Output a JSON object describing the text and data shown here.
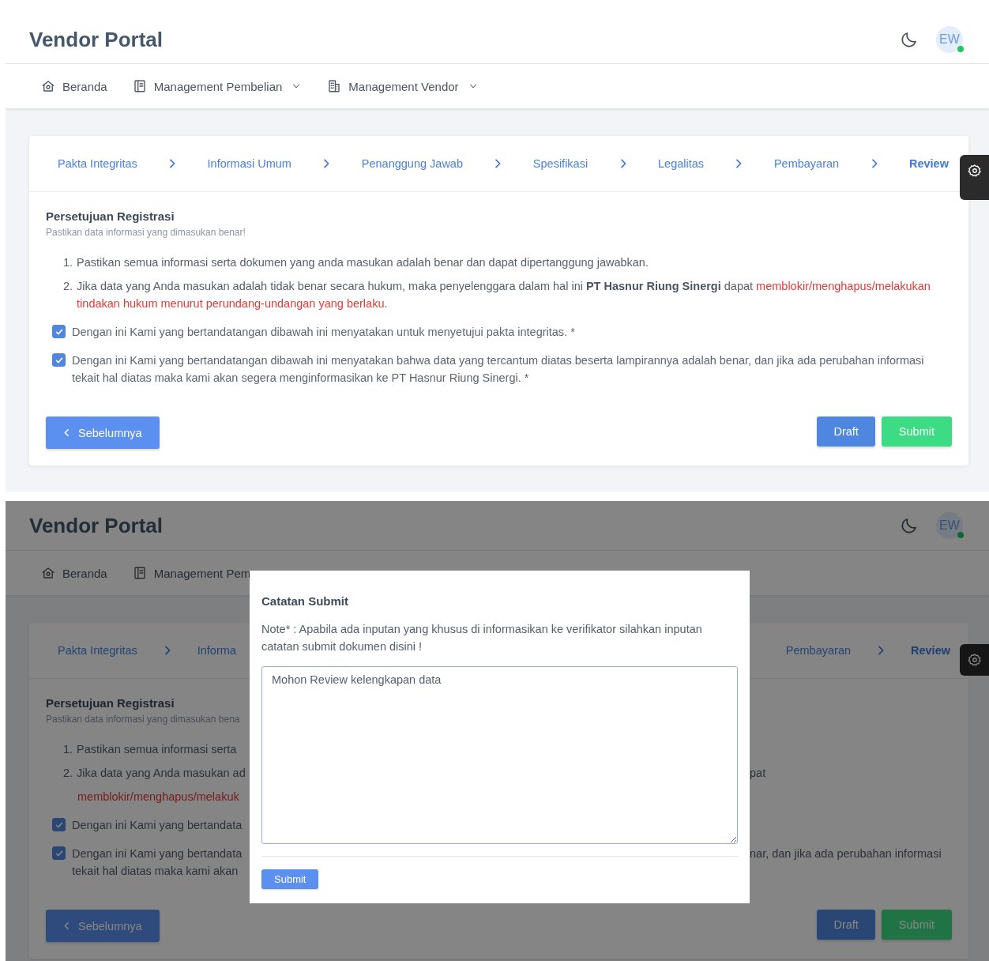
{
  "review_page": {
    "header": {
      "title": "Vendor Portal",
      "avatar": "EW",
      "online": true
    },
    "nav": [
      {
        "label": "Beranda",
        "dropdown": false
      },
      {
        "label": "Management Pembelian",
        "dropdown": true
      },
      {
        "label": "Management Vendor",
        "dropdown": true
      }
    ],
    "steps": [
      {
        "label": "Pakta Integritas",
        "selected": false
      },
      {
        "label": "Informasi Umum",
        "selected": false
      },
      {
        "label": "Penanggung Jawab",
        "selected": false
      },
      {
        "label": "Spesifikasi",
        "selected": false
      },
      {
        "label": "Legalitas",
        "selected": false
      },
      {
        "label": "Pembayaran",
        "selected": false
      },
      {
        "label": "Review",
        "selected": true
      }
    ],
    "section": {
      "title": "Persetujuan Registrasi",
      "subtitle": "Pastikan data informasi yang dimasukan benar!"
    },
    "terms": [
      {
        "number": "1.",
        "parts": [
          {
            "kind": "text",
            "text": "Pastikan semua informasi serta dokumen yang anda masukan adalah benar dan dapat dipertanggung jawabkan."
          }
        ]
      },
      {
        "number": "2.",
        "parts": [
          {
            "kind": "text",
            "text": "Jika data yang Anda masukan adalah tidak benar secara hukum, maka penyelenggara dalam hal ini **PT Hasnur Riung Sinergi** dapat "
          },
          {
            "kind": "warning",
            "text": "memblokir/menghapus/melakukan tindakan hukum menurut perundang-undangan yang berlaku"
          },
          {
            "kind": "text",
            "text": "."
          }
        ]
      }
    ],
    "agreements": [
      {
        "label": "Dengan ini Kami yang bertandatangan dibawah ini menyatakan untuk menyetujui pakta integritas. *",
        "checked": true
      },
      {
        "label": "Dengan ini Kami yang bertandatangan dibawah ini menyatakan bahwa data yang tercantum diatas beserta lampirannya adalah benar, dan jika ada perubahan informasi tekait hal diatas maka kami akan segera menginformasikan ke PT Hasnur Riung Sinergi. *",
        "checked": true
      }
    ],
    "buttons": {
      "back": "Sebelumnya",
      "draft": "Draft",
      "submit": "Submit"
    }
  },
  "dialog_page": {
    "header": {
      "title": "Vendor Portal",
      "avatar": "EW",
      "online": true
    },
    "nav": [
      {
        "label": "Beranda",
        "dropdown": false
      },
      {
        "label": "Management Pem",
        "dropdown": false
      }
    ],
    "steps_left": [
      {
        "label": "Pakta Integritas",
        "selected": false
      },
      {
        "label": "Informa",
        "selected": false
      }
    ],
    "steps_right": [
      {
        "label": "Pembayaran",
        "selected": false
      },
      {
        "label": "Review",
        "selected": true
      }
    ],
    "section": {
      "title": "Persetujuan Registrasi",
      "subtitle": "Pastikan data informasi yang dimasukan bena"
    },
    "fragments": [
      {
        "kind": "list",
        "number": "1.",
        "left": [
          {
            "kind": "text",
            "text": "Pastikan semua informasi serta"
          }
        ]
      },
      {
        "kind": "list",
        "number": "2.",
        "left": [
          {
            "kind": "text",
            "text": "Jika data yang Anda masukan ad"
          }
        ],
        "right": "pat"
      },
      {
        "kind": "continuation",
        "left": [
          {
            "kind": "warning",
            "text": "memblokir/menghapus/melakuk"
          }
        ]
      },
      {
        "kind": "checkbox",
        "checked": true,
        "left": [
          {
            "kind": "text",
            "text": "Dengan ini Kami yang bertandata"
          }
        ]
      },
      {
        "kind": "checkbox",
        "checked": true,
        "left": [
          {
            "kind": "text",
            "text": "Dengan ini Kami yang bertandata"
          }
        ],
        "right": "nar, dan jika ada perubahan informasi"
      },
      {
        "kind": "continuation",
        "left": [
          {
            "kind": "text",
            "text": "tekait hal diatas maka kami akan"
          }
        ]
      }
    ],
    "buttons": {
      "back": "Sebelumnya",
      "draft": "Draft",
      "submit": "Submit"
    },
    "dialog": {
      "title": "Catatan Submit",
      "note": "Note* : Apabila ada inputan yang khusus di informasikan ke verifikator silahkan inputan catatan submit dokumen disini !",
      "value": "Mohon Review kelengkapan data",
      "submit": "Submit"
    }
  }
}
